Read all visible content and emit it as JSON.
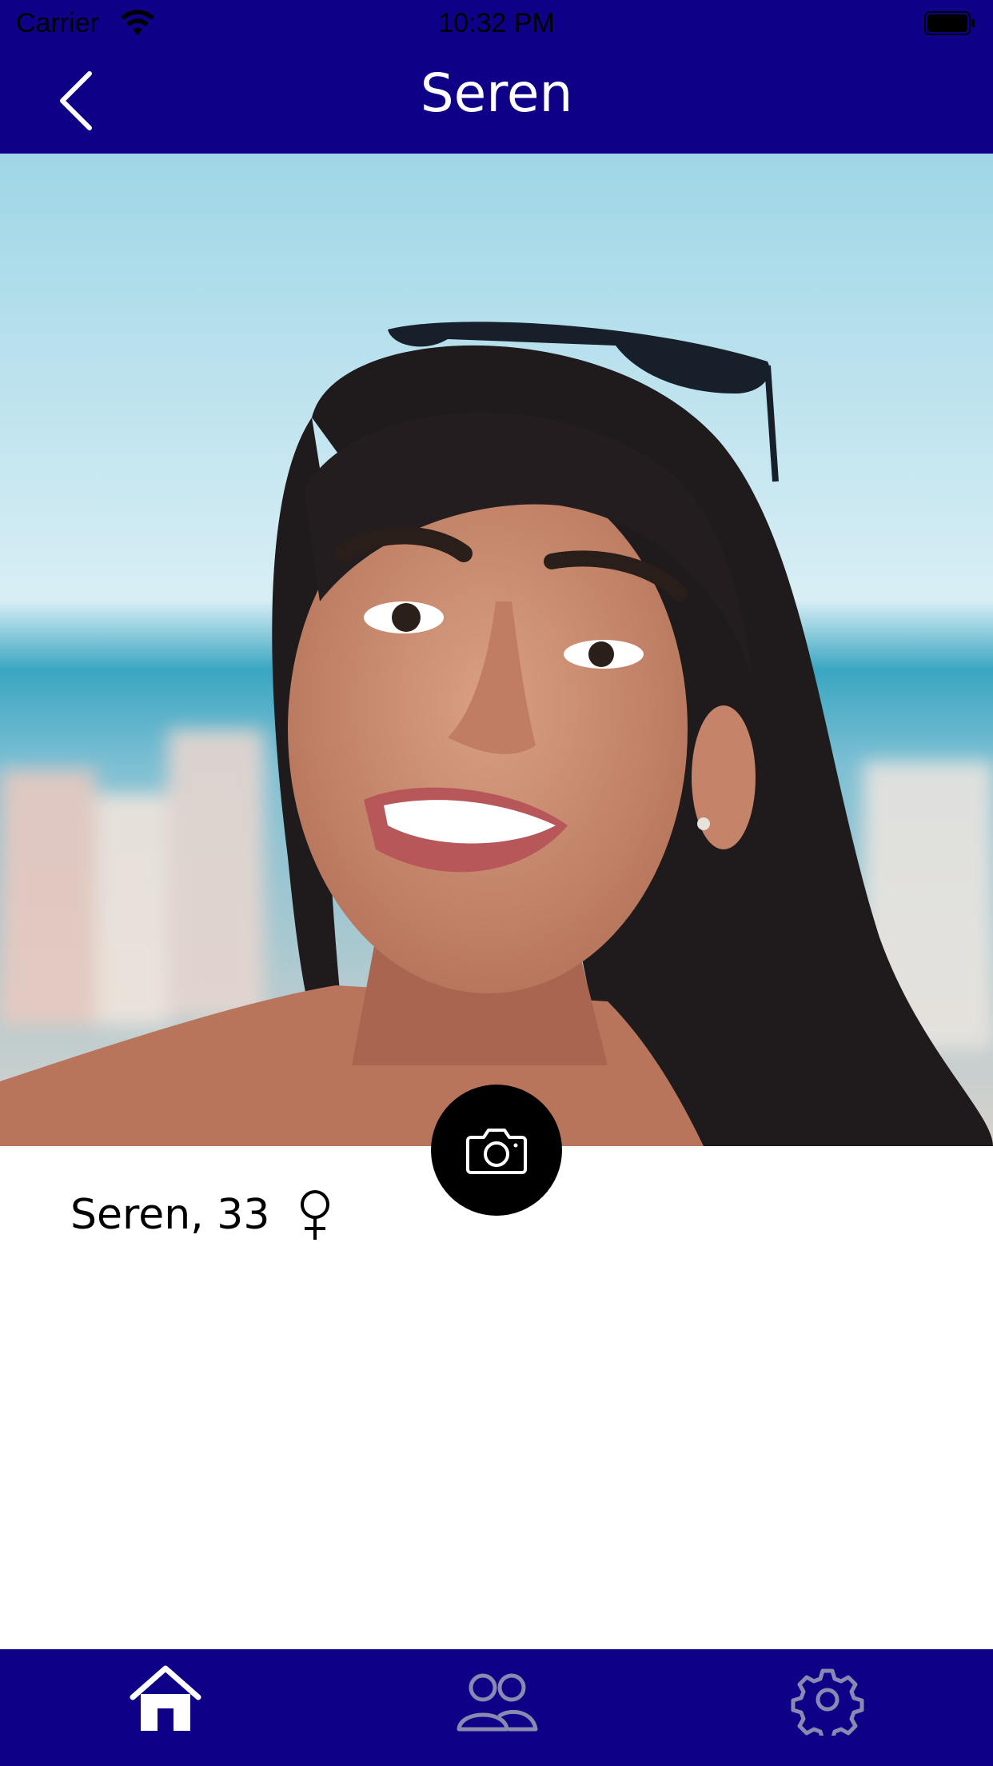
{
  "status_bar": {
    "carrier": "Carrier",
    "time": "10:32 PM",
    "icons": [
      "wifi-icon",
      "battery-icon"
    ]
  },
  "nav": {
    "title": "Seren",
    "back_icon": "chevron-left-icon"
  },
  "profile": {
    "name_age": "Seren, 33",
    "gender_icon": "female-symbol-icon",
    "photo": "profile-photo"
  },
  "camera_button": {
    "icon": "camera-icon"
  },
  "tab_bar": {
    "tabs": [
      {
        "name": "home",
        "icon": "home-icon",
        "active": true
      },
      {
        "name": "people",
        "icon": "people-icon",
        "active": false
      },
      {
        "name": "settings",
        "icon": "gear-icon",
        "active": false
      }
    ]
  },
  "colors": {
    "brand": "#0f0088",
    "active_tab": "#ffffff",
    "inactive_tab": "#8a8ab0",
    "camera_bg": "#000000"
  }
}
